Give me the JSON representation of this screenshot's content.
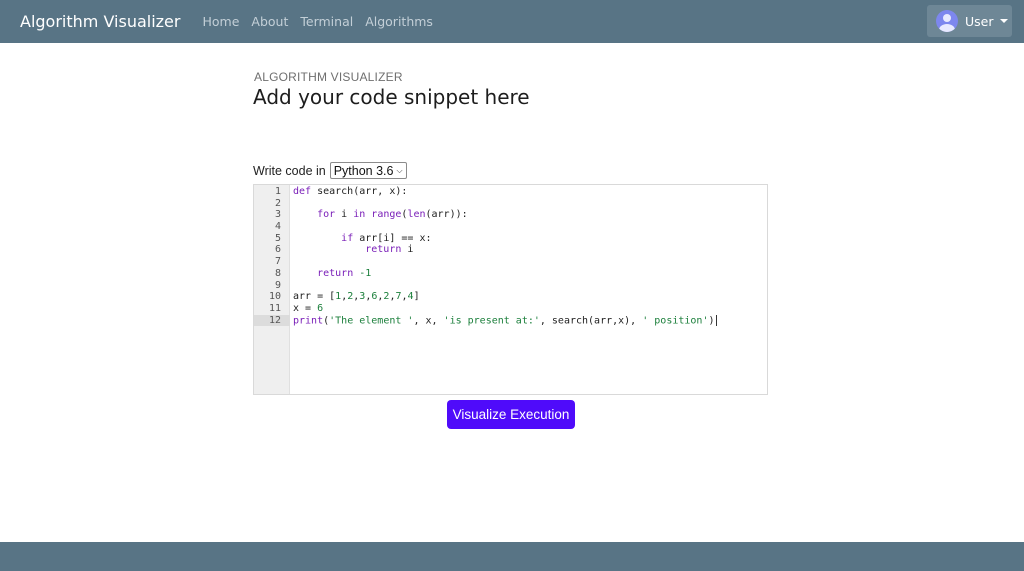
{
  "navbar": {
    "brand": "Algorithm Visualizer",
    "links": [
      "Home",
      "About",
      "Terminal",
      "Algorithms"
    ],
    "user_label": "User",
    "user_icon": "user-avatar-icon"
  },
  "header": {
    "kicker": "ALGORITHM VISUALIZER",
    "title": "Add your code snippet here"
  },
  "language": {
    "label": "Write code in",
    "selected": "Python 3.6"
  },
  "editor": {
    "active_line": 12,
    "lines": [
      {
        "n": "1",
        "tokens": [
          {
            "t": "def",
            "c": "#7a1fb8"
          },
          {
            "t": " search(arr, x):",
            "c": "#222222"
          }
        ]
      },
      {
        "n": "2",
        "tokens": []
      },
      {
        "n": "3",
        "tokens": [
          {
            "t": "    ",
            "c": "#222222"
          },
          {
            "t": "for",
            "c": "#7a1fb8"
          },
          {
            "t": " i ",
            "c": "#222222"
          },
          {
            "t": "in",
            "c": "#7a1fb8"
          },
          {
            "t": " ",
            "c": "#222222"
          },
          {
            "t": "range",
            "c": "#7a1fb8"
          },
          {
            "t": "(",
            "c": "#222222"
          },
          {
            "t": "len",
            "c": "#7a1fb8"
          },
          {
            "t": "(arr)):",
            "c": "#222222"
          }
        ]
      },
      {
        "n": "4",
        "tokens": []
      },
      {
        "n": "5",
        "tokens": [
          {
            "t": "        ",
            "c": "#222222"
          },
          {
            "t": "if",
            "c": "#7a1fb8"
          },
          {
            "t": " arr[i] == x:",
            "c": "#222222"
          }
        ]
      },
      {
        "n": "6",
        "tokens": [
          {
            "t": "            ",
            "c": "#222222"
          },
          {
            "t": "return",
            "c": "#7a1fb8"
          },
          {
            "t": " i",
            "c": "#222222"
          }
        ]
      },
      {
        "n": "7",
        "tokens": []
      },
      {
        "n": "8",
        "tokens": [
          {
            "t": "    ",
            "c": "#222222"
          },
          {
            "t": "return",
            "c": "#7a1fb8"
          },
          {
            "t": " ",
            "c": "#222222"
          },
          {
            "t": "-1",
            "c": "#1b7f3b"
          }
        ]
      },
      {
        "n": "9",
        "tokens": []
      },
      {
        "n": "10",
        "tokens": [
          {
            "t": "arr = [",
            "c": "#222222"
          },
          {
            "t": "1",
            "c": "#1b7f3b"
          },
          {
            "t": ",",
            "c": "#222222"
          },
          {
            "t": "2",
            "c": "#1b7f3b"
          },
          {
            "t": ",",
            "c": "#222222"
          },
          {
            "t": "3",
            "c": "#1b7f3b"
          },
          {
            "t": ",",
            "c": "#222222"
          },
          {
            "t": "6",
            "c": "#1b7f3b"
          },
          {
            "t": ",",
            "c": "#222222"
          },
          {
            "t": "2",
            "c": "#1b7f3b"
          },
          {
            "t": ",",
            "c": "#222222"
          },
          {
            "t": "7",
            "c": "#1b7f3b"
          },
          {
            "t": ",",
            "c": "#222222"
          },
          {
            "t": "4",
            "c": "#1b7f3b"
          },
          {
            "t": "]",
            "c": "#222222"
          }
        ]
      },
      {
        "n": "11",
        "tokens": [
          {
            "t": "x = ",
            "c": "#222222"
          },
          {
            "t": "6",
            "c": "#1b7f3b"
          }
        ]
      },
      {
        "n": "12",
        "tokens": [
          {
            "t": "print",
            "c": "#7a1fb8"
          },
          {
            "t": "(",
            "c": "#222222"
          },
          {
            "t": "'The element '",
            "c": "#1b7f3b"
          },
          {
            "t": ", x, ",
            "c": "#222222"
          },
          {
            "t": "'is present at:'",
            "c": "#1b7f3b"
          },
          {
            "t": ", search(arr,x), ",
            "c": "#222222"
          },
          {
            "t": "' position'",
            "c": "#1b7f3b"
          },
          {
            "t": ")",
            "c": "#222222"
          }
        ]
      }
    ]
  },
  "actions": {
    "visualize_label": "Visualize Execution"
  },
  "colors": {
    "navbar": "#587485",
    "accent": "#4f0bfa",
    "keyword": "#7a1fb8",
    "literal": "#1b7f3b"
  }
}
